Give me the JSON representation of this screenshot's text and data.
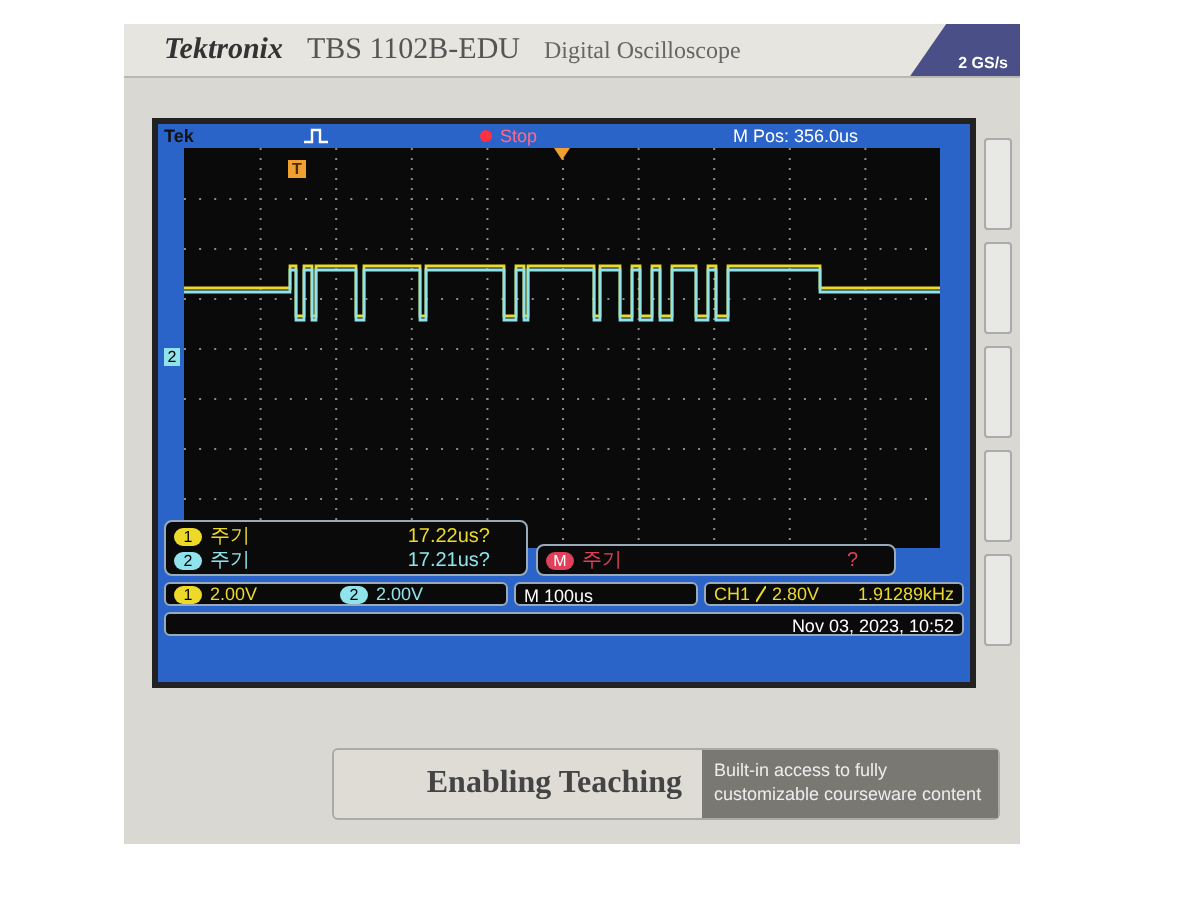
{
  "header": {
    "brand": "Tektronix",
    "model": "TBS 1102B-EDU",
    "product": "Digital Oscilloscope",
    "spec": "2 GS/s"
  },
  "screen": {
    "logo": "Tek",
    "run_state": "Stop",
    "m_pos": "M Pos: 356.0us",
    "trigger_marker": "T",
    "ground_marker": "2",
    "measurements": [
      {
        "channel": "1",
        "label": "주기",
        "value": "17.22us?",
        "color": "#ecd92a"
      },
      {
        "channel": "2",
        "label": "주기",
        "value": "17.21us?",
        "color": "#8fe3ea"
      }
    ],
    "math": {
      "channel": "M",
      "label": "주기",
      "value": "?",
      "color": "#e0405a"
    },
    "scales": [
      {
        "channel": "1",
        "value": "2.00V",
        "color": "#ecd92a"
      },
      {
        "channel": "2",
        "value": "2.00V",
        "color": "#8fe3ea"
      }
    ],
    "timebase": "M 100us",
    "trigger_source": "CH1",
    "trigger_level": "2.80V",
    "frequency": "1.91289kHz",
    "datetime": "Nov 03, 2023, 10:52"
  },
  "footer": {
    "slogan": "Enabling Teaching",
    "description": "Built-in access to fully customizable courseware content"
  }
}
